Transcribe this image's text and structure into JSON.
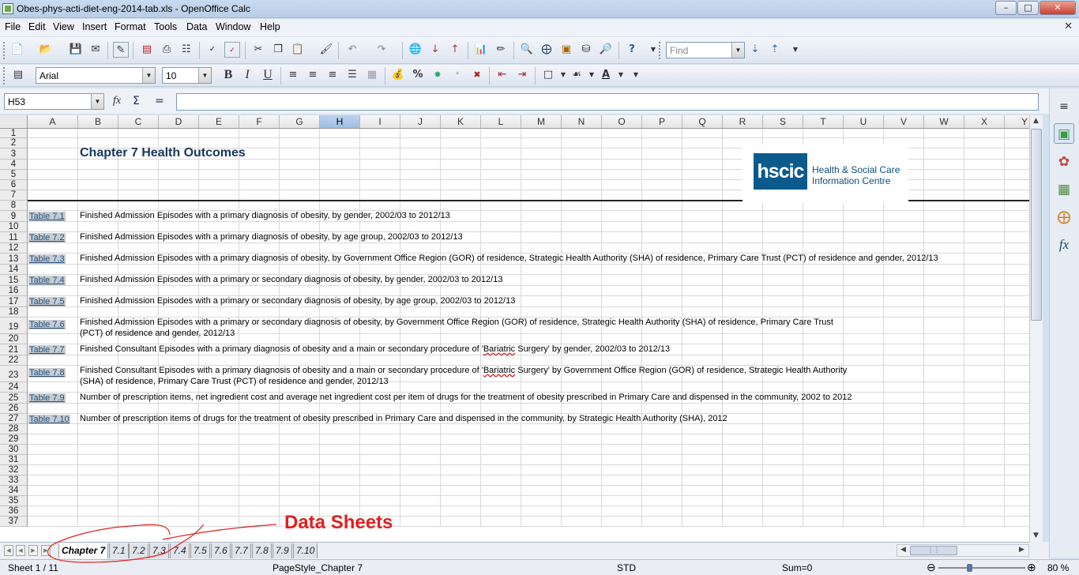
{
  "window": {
    "title": "Obes-phys-acti-diet-eng-2014-tab.xls - OpenOffice Calc",
    "min": "–",
    "max": "□",
    "close": "✕"
  },
  "menu": [
    "File",
    "Edit",
    "View",
    "Insert",
    "Format",
    "Tools",
    "Data",
    "Window",
    "Help"
  ],
  "menu_close": "✕",
  "find": {
    "placeholder": "Find"
  },
  "format": {
    "font": "Arial",
    "size": "10",
    "bold": "B",
    "italic": "I",
    "underline": "U",
    "percent": "%"
  },
  "formula": {
    "cellref": "H53",
    "value": ""
  },
  "columns": [
    "A",
    "B",
    "C",
    "D",
    "E",
    "F",
    "G",
    "H",
    "I",
    "J",
    "K",
    "L",
    "M",
    "N",
    "O",
    "P",
    "Q",
    "R",
    "S",
    "T",
    "U",
    "V",
    "W",
    "X",
    "Y"
  ],
  "selected_column": "H",
  "rows": [
    "1",
    "2",
    "3",
    "4",
    "5",
    "6",
    "7",
    "8",
    "9",
    "10",
    "11",
    "12",
    "13",
    "14",
    "15",
    "16",
    "17",
    "18",
    "19",
    "20",
    "21",
    "22",
    "23",
    "24",
    "25",
    "26",
    "27",
    "28",
    "29",
    "30",
    "31",
    "32",
    "33",
    "34",
    "35",
    "36",
    "37"
  ],
  "sheet": {
    "heading": "Chapter 7 Health Outcomes",
    "logo": {
      "mark": "hscic",
      "line1": "Health & Social Care",
      "line2": "Information Centre"
    },
    "tables": [
      {
        "link": "Table 7.1",
        "desc": "Finished Admission Episodes with a primary diagnosis of obesity, by gender, 2002/03 to 2012/13"
      },
      {
        "link": "Table 7.2",
        "desc": "Finished Admission Episodes with a primary diagnosis of obesity, by age group, 2002/03 to 2012/13"
      },
      {
        "link": "Table 7.3",
        "desc": "Finished Admission Episodes with a primary diagnosis of obesity, by Government Office Region (GOR) of residence, Strategic Health Authority (SHA) of residence, Primary Care Trust (PCT) of residence and gender, 2012/13"
      },
      {
        "link": "Table 7.4",
        "desc": "Finished Admission Episodes with a primary or secondary diagnosis of obesity, by gender, 2002/03 to 2012/13"
      },
      {
        "link": "Table 7.5",
        "desc": "Finished Admission Episodes with a primary or secondary diagnosis of obesity, by age group, 2002/03 to 2012/13"
      },
      {
        "link": "Table 7.6",
        "desc": "Finished Admission Episodes with a primary or secondary diagnosis of obesity, by Government Office Region (GOR) of residence, Strategic Health Authority (SHA) of residence, Primary Care Trust",
        "desc2": "(PCT) of residence and gender, 2012/13"
      },
      {
        "link": "Table 7.7",
        "desc_pre": "Finished Consultant Episodes with a primary diagnosis of obesity and a main or secondary procedure of '",
        "desc_sq": "Bariatric",
        "desc_post": " Surgery' by gender, 2002/03 to 2012/13"
      },
      {
        "link": "Table 7.8",
        "desc_pre": "Finished Consultant Episodes with a primary diagnosis of obesity and a main or secondary procedure of '",
        "desc_sq": "Bariatric",
        "desc_post": " Surgery' by Government Office Region (GOR) of residence, Strategic Health Authority",
        "desc2": "(SHA)  of residence, Primary Care Trust (PCT) of residence and gender, 2012/13"
      },
      {
        "link": "Table 7.9",
        "desc": "Number of prescription items, net ingredient cost and average net ingredient cost per item of drugs for the treatment of obesity prescribed in Primary Care and dispensed in the community, 2002 to 2012"
      },
      {
        "link": "Table 7.10",
        "desc": "Number of prescription items of drugs for the treatment of obesity prescribed in Primary Care and dispensed in the community, by Strategic Health Authority (SHA), 2012"
      }
    ]
  },
  "tabs": [
    "Chapter 7",
    "7.1",
    "7.2",
    "7.3",
    "7.4",
    "7.5",
    "7.6",
    "7.7",
    "7.8",
    "7.9",
    "7.10"
  ],
  "active_tab": "Chapter 7",
  "annotation": {
    "text": "Data Sheets",
    "color": "#e02020"
  },
  "status": {
    "sheet": "Sheet 1 / 11",
    "pagestyle": "PageStyle_Chapter 7",
    "mode": "STD",
    "sum": "Sum=0",
    "zoom": "80 %",
    "zoom_level_percent": 80
  }
}
